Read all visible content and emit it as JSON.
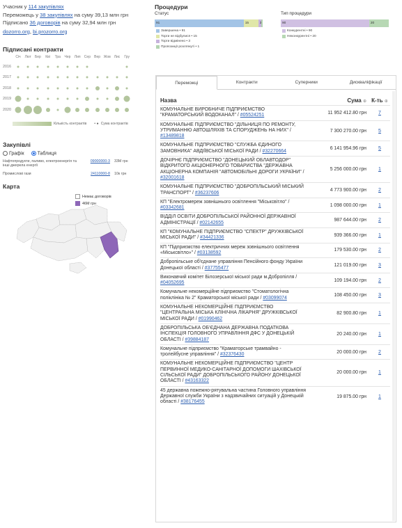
{
  "summary": {
    "line1_prefix": "Учасник у ",
    "line1_link": "114 закупівлях",
    "line2_prefix": "Переможець у ",
    "line2_link": "38 закупівлях",
    "line2_suffix": " на суму 39,13 млн грн",
    "line3_prefix": "Підписано ",
    "line3_link": "36 договорів",
    "line3_suffix": " на суму 32,94 млн грн",
    "link_a": "dozorro.org",
    "link_sep": ", ",
    "link_b": "bi.prozorro.org"
  },
  "contracts": {
    "title": "Підписані контракти",
    "months": [
      "Січ",
      "Лют",
      "Бер",
      "Кві",
      "Тра",
      "Чер",
      "Лип",
      "Сер",
      "Вер",
      "Жов",
      "Лис",
      "Гру"
    ],
    "years": [
      "2016",
      "2017",
      "2018",
      "2019",
      "2020"
    ],
    "legend_count": "Кількість контрактів",
    "legend_sum": "Сума контрактів",
    "color": "#b3c59d",
    "dots": [
      [
        1,
        1,
        1,
        1,
        1,
        1,
        1,
        1,
        0,
        0,
        0,
        1
      ],
      [
        1,
        1,
        1,
        1,
        1,
        1,
        1,
        1,
        1,
        1,
        1,
        1
      ],
      [
        1,
        1,
        1,
        1,
        1,
        1,
        1,
        1,
        2,
        1,
        2,
        1
      ],
      [
        3,
        1,
        1,
        1,
        1,
        1,
        1,
        2,
        1,
        1,
        2,
        3
      ],
      [
        3,
        4,
        4,
        2,
        1,
        3,
        2,
        2,
        2,
        2,
        2,
        2
      ]
    ]
  },
  "zakupivli": {
    "title": "Закупівлі",
    "radio_chart": "Графік",
    "radio_table": "Таблиця",
    "rows": [
      {
        "name": "Нафтопродукти, паливо, електроенергія та інші джерела енергії",
        "code": "09000000-3",
        "sum": "33M грн"
      },
      {
        "name": "Промислові гази",
        "code": "24110000-8",
        "sum": "10к грн"
      }
    ]
  },
  "map": {
    "title": "Карта",
    "legend_none": "Немає договорів",
    "legend_value": "46M грн",
    "highlight_color": "#8e67b8"
  },
  "procedures": {
    "title": "Процедури",
    "status_label": "Статус",
    "type_label": "Тип процедури",
    "status_segments": [
      {
        "label": "91",
        "value": 91,
        "color": "#a3c4e6"
      },
      {
        "label": "15",
        "value": 15,
        "color": "#e0e7a8"
      },
      {
        "label": "3",
        "value": 3,
        "color": "#c7b3dd"
      },
      {
        "label": "1",
        "value": 1,
        "color": "#b3d4b0"
      }
    ],
    "status_legend": [
      {
        "label": "Завершена • 91",
        "color": "#a3c4e6"
      },
      {
        "label": "Торги не відбулися • 15",
        "color": "#e0e7a8"
      },
      {
        "label": "Торги відмінено • 3",
        "color": "#c7b3dd"
      },
      {
        "label": "Пропозиції розглянуті • 1",
        "color": "#b3d4b0"
      }
    ],
    "type_segments": [
      {
        "label": "90",
        "value": 90,
        "color": "#d0c0e2"
      },
      {
        "label": "20",
        "value": 20,
        "color": "#b7d8b4"
      }
    ],
    "type_legend": [
      {
        "label": "Конкурентні • 90",
        "color": "#d0c0e2"
      },
      {
        "label": "Неконкурентні • 20",
        "color": "#b7d8b4"
      }
    ]
  },
  "tabs": [
    "Переможці",
    "Контракти",
    "Суперники",
    "Дискваліфікації"
  ],
  "table": {
    "col_name": "Назва",
    "col_sum": "Сума",
    "col_count": "К-ть",
    "rows": [
      {
        "name": "КОМУНАЛЬНЕ ВИРОБНИЧЕ ПІДПРИЄМСТВО \"КРАМАТОРСЬКИЙ ВОДОКАНАЛ\" / ",
        "code": "#05524251",
        "sum": "11 952 412.80 грн",
        "count": "7"
      },
      {
        "name": "КОМУНАЛЬНЕ ПІДПРИЄМСТВО \"ДІЛЬНИЦЯ ПО РЕМОНТУ, УТРИМАННЮ АВТОШЛЯХІВ ТА СПОРУДЖЕНЬ НА НИХ\" / ",
        "code": "#13489818",
        "sum": "7 300 270.00 грн",
        "count": "5"
      },
      {
        "name": "КОМУНАЛЬНЕ ПІДПРИЄМСТВО \"СЛУЖБА ЄДИНОГО ЗАМОВНИКА\" АВДІЇВСЬКОЇ МІСЬКОЇ РАДИ / ",
        "code": "#32270664",
        "sum": "6 141 954.96 грн",
        "count": "5"
      },
      {
        "name": "ДОЧІРНЄ ПІДПРИЄМСТВО \"ДОНЕЦЬКИЙ ОБЛАВТОДОР\" ВІДКРИТОГО АКЦІОНЕРНОГО ТОВАРИСТВА \"ДЕРЖАВНА АКЦІОНЕРНА КОМПАНІЯ \"АВТОМОБІЛЬНІ ДОРОГИ УКРАЇНИ\" / ",
        "code": "#32001618",
        "sum": "5 256 000.00 грн",
        "count": "1"
      },
      {
        "name": "КОМУНАЛЬНЕ ПІДПРИЄМСТВО \"ДОБРОПІЛЬСЬКИЙ МІСЬКИЙ ТРАНСПОРТ\" / ",
        "code": "#36237606",
        "sum": "4 773 900.00 грн",
        "count": "2"
      },
      {
        "name": "КП \"Електромереж зовнішнього освітлення \"Міськсвітло\" / ",
        "code": "#03342681",
        "sum": "1 098 000.00 грн",
        "count": "1"
      },
      {
        "name": "ВІДДІЛ ОСВІТИ ДОБРОПІЛЬСЬКОЇ РАЙОННОЇ ДЕРЖАВНОЇ АДМІНІСТРАЦІЇ / ",
        "code": "#02142655",
        "sum": "987 644.00 грн",
        "count": "2"
      },
      {
        "name": "КП \"КОМУНАЛЬНЕ ПІДПРИЄМСТВО \"СПЕКТР\" ДРУЖКІВСЬКОЇ МІСЬКОЇ РАДИ\" / ",
        "code": "#34421336",
        "sum": "939 366.00 грн",
        "count": "1"
      },
      {
        "name": "КП \"Підприємство електричних мереж зовнішнього освітлення «Міськсвітло»\" / ",
        "code": "#03138592",
        "sum": "179 530.00 грн",
        "count": "2"
      },
      {
        "name": "Добропільське об'єднане управління Пенсійного фонду України Донецької області / ",
        "code": "#37755477",
        "sum": "121 019.00 грн",
        "count": "3"
      },
      {
        "name": "Виконавчий комітет Білозерської міської ради м.Добропілля / ",
        "code": "#04052695",
        "sum": "109 194.00 грн",
        "count": "2"
      },
      {
        "name": "Комунальне некомерційне підприємство \"Стоматологічна поліклініка № 2\" Краматорської міської ради / ",
        "code": "#03099074",
        "sum": "108 450.00 грн",
        "count": "3"
      },
      {
        "name": "КОМУНАЛЬНЕ НЕКОМЕРЦІЙНЕ ПІДПРИЄМСТВО \"ЦЕНТРАЛЬНА МІСЬКА КЛІНІЧНА ЛІКАРНЯ\" ДРУЖКІВСЬКОЇ МІСЬКОЇ РАДИ / ",
        "code": "#01990462",
        "sum": "82 900.80 грн",
        "count": "1"
      },
      {
        "name": "ДОБРОПІЛЬСЬКА ОБ'ЄДНАНА ДЕРЖАВНА ПОДАТКОВА ІНСПЕКЦІЯ ГОЛОВНОГО УПРАВЛІННЯ ДФС У ДОНЕЦЬКІЙ ОБЛАСТІ / ",
        "code": "#39884187",
        "sum": "20 240.00 грн",
        "count": "1"
      },
      {
        "name": "Комунальне підприємство \"Краматорське трамвайно - тролейбусне управління\" / ",
        "code": "#32376430",
        "sum": "20 000.00 грн",
        "count": "2"
      },
      {
        "name": "КОМУНАЛЬНЕ НЕКОМЕРЦІЙНЕ ПІДПРИЄМСТВО \"ЦЕНТР ПЕРВИННОЇ МЕДИКО-САНІТАРНОЇ ДОПОМОГИ ШАХІВСЬКОЇ СІЛЬСЬКОЇ РАДИ\" ДОБРОПІЛЬСЬКОГО РАЙОНУ ДОНЕЦЬКОЇ ОБЛАСТІ / ",
        "code": "#43163322",
        "sum": "20 000.00 грн",
        "count": "1"
      },
      {
        "name": "45 державна пожежно-рятувальна частина Головного управління Державної служби України з надзвичайних ситуацій у Донецькій області / ",
        "code": "#38176455",
        "sum": "19 875.00 грн",
        "count": "1"
      }
    ]
  }
}
